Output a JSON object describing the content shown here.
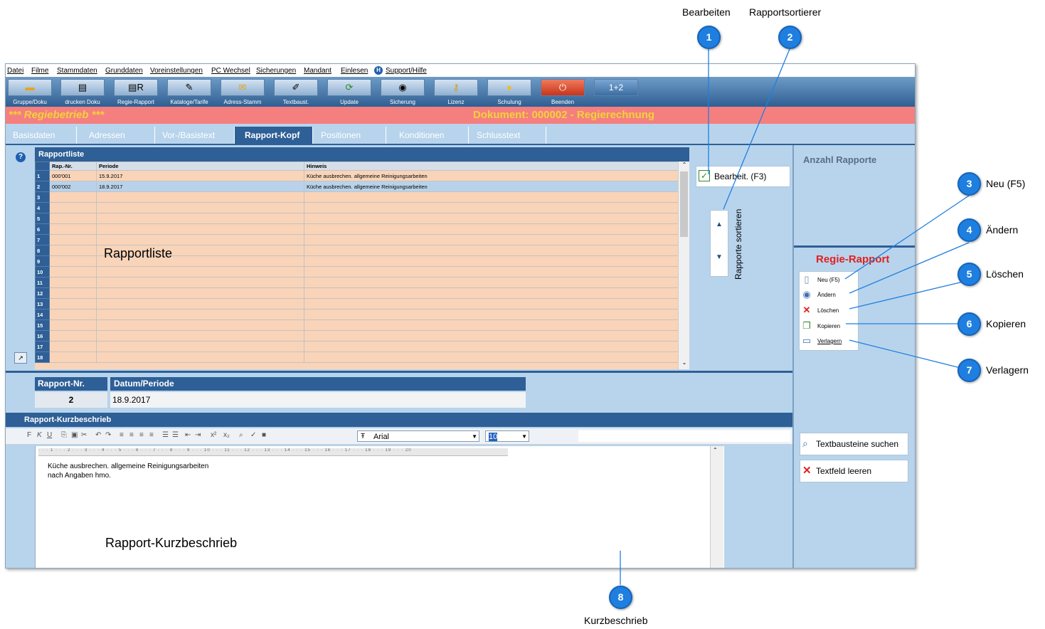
{
  "menu": [
    "Datei",
    "Filme",
    "Stammdaten",
    "Grunddaten",
    "Voreinstellungen",
    "PC Wechsel",
    "Sicherungen",
    "Mandant",
    "Einlesen",
    "Support/Hilfe"
  ],
  "toolbar": [
    {
      "label": "Gruppe/Doku",
      "icon": "folder-icon"
    },
    {
      "label": "drucken Doku",
      "icon": "printer-icon"
    },
    {
      "label": "Regie-Rapport",
      "icon": "printer-report-icon"
    },
    {
      "label": "Kataloge/Tarife",
      "icon": "catalog-icon"
    },
    {
      "label": "Adress-Stamm",
      "icon": "address-icon"
    },
    {
      "label": "Textbaust.",
      "icon": "text-module-icon"
    },
    {
      "label": "Update",
      "icon": "update-icon"
    },
    {
      "label": "Sicherung",
      "icon": "backup-icon"
    },
    {
      "label": "Lizenz",
      "icon": "key-icon"
    },
    {
      "label": "Schulung",
      "icon": "lightbulb-icon"
    },
    {
      "label": "Beenden",
      "icon": "power-icon"
    },
    {
      "label": "",
      "icon": "calculator-icon",
      "text": "1+2"
    }
  ],
  "header": {
    "left": "*** Regiebetrieb ***",
    "right": "Dokument: 000002 - Regierechnung"
  },
  "tabs": [
    "Basisdaten",
    "Adressen",
    "Vor-/Basistext",
    "Rapport-Kopf",
    "Positionen",
    "Konditionen",
    "Schlusstext"
  ],
  "active_tab": "Rapport-Kopf",
  "rapportliste": {
    "title": "Rapportliste",
    "columns": [
      "Rap.-Nr.",
      "Periode",
      "Hinweis"
    ],
    "rows": [
      {
        "n": "1",
        "nr": "000'001",
        "periode": "15.9.2017",
        "hinweis": "Küche ausbrechen. allgemeine Reinigungsarbeiten"
      },
      {
        "n": "2",
        "nr": "000'002",
        "periode": "18.9.2017",
        "hinweis": "Küche ausbrechen. allgemeine Reinigungsarbeiten"
      },
      {
        "n": "3"
      },
      {
        "n": "4"
      },
      {
        "n": "5"
      },
      {
        "n": "6"
      },
      {
        "n": "7"
      },
      {
        "n": "8"
      },
      {
        "n": "9"
      },
      {
        "n": "10"
      },
      {
        "n": "11"
      },
      {
        "n": "12"
      },
      {
        "n": "13"
      },
      {
        "n": "14"
      },
      {
        "n": "15"
      },
      {
        "n": "16"
      },
      {
        "n": "17"
      },
      {
        "n": "18"
      }
    ],
    "overlay_label": "Rapportliste"
  },
  "bearbeiten_button": "Bearbeit. (F3)",
  "sorter": {
    "label": "Rapporte sortieren",
    "up": "▲",
    "down": "▼"
  },
  "anzahl_label": "Anzahl Rapporte",
  "regie_title": "Regie-Rapport",
  "side_buttons": [
    {
      "label": "Neu (F5)",
      "icon": "new-document-icon"
    },
    {
      "label": "Ändern",
      "icon": "edit-icon"
    },
    {
      "label": "Löschen",
      "icon": "delete-icon"
    },
    {
      "label": "Kopieren",
      "icon": "copy-icon"
    },
    {
      "label": "Verlagern",
      "icon": "move-icon"
    }
  ],
  "rapport_nr": {
    "label": "Rapport-Nr.",
    "value": "2"
  },
  "datum": {
    "label": "Datum/Periode",
    "value": "18.9.2017"
  },
  "kurz": {
    "title": "Rapport-Kurzbeschrieb",
    "font": "Arial",
    "size": "10",
    "lines": [
      "Küche ausbrechen. allgemeine Reinigungsarbeiten",
      "nach Angaben hmo."
    ],
    "overlay_label": "Rapport-Kurzbeschrieb"
  },
  "textbausteine": "Textbausteine suchen",
  "textfeld_leeren": "Textfeld leeren",
  "callouts": [
    {
      "n": "1",
      "label": "Bearbeiten"
    },
    {
      "n": "2",
      "label": "Rapportsortierer"
    },
    {
      "n": "3",
      "label": "Neu (F5)"
    },
    {
      "n": "4",
      "label": "Ändern"
    },
    {
      "n": "5",
      "label": "Löschen"
    },
    {
      "n": "6",
      "label": "Kopieren"
    },
    {
      "n": "7",
      "label": "Verlagern"
    },
    {
      "n": "8",
      "label": "Kurzbeschrieb"
    }
  ]
}
